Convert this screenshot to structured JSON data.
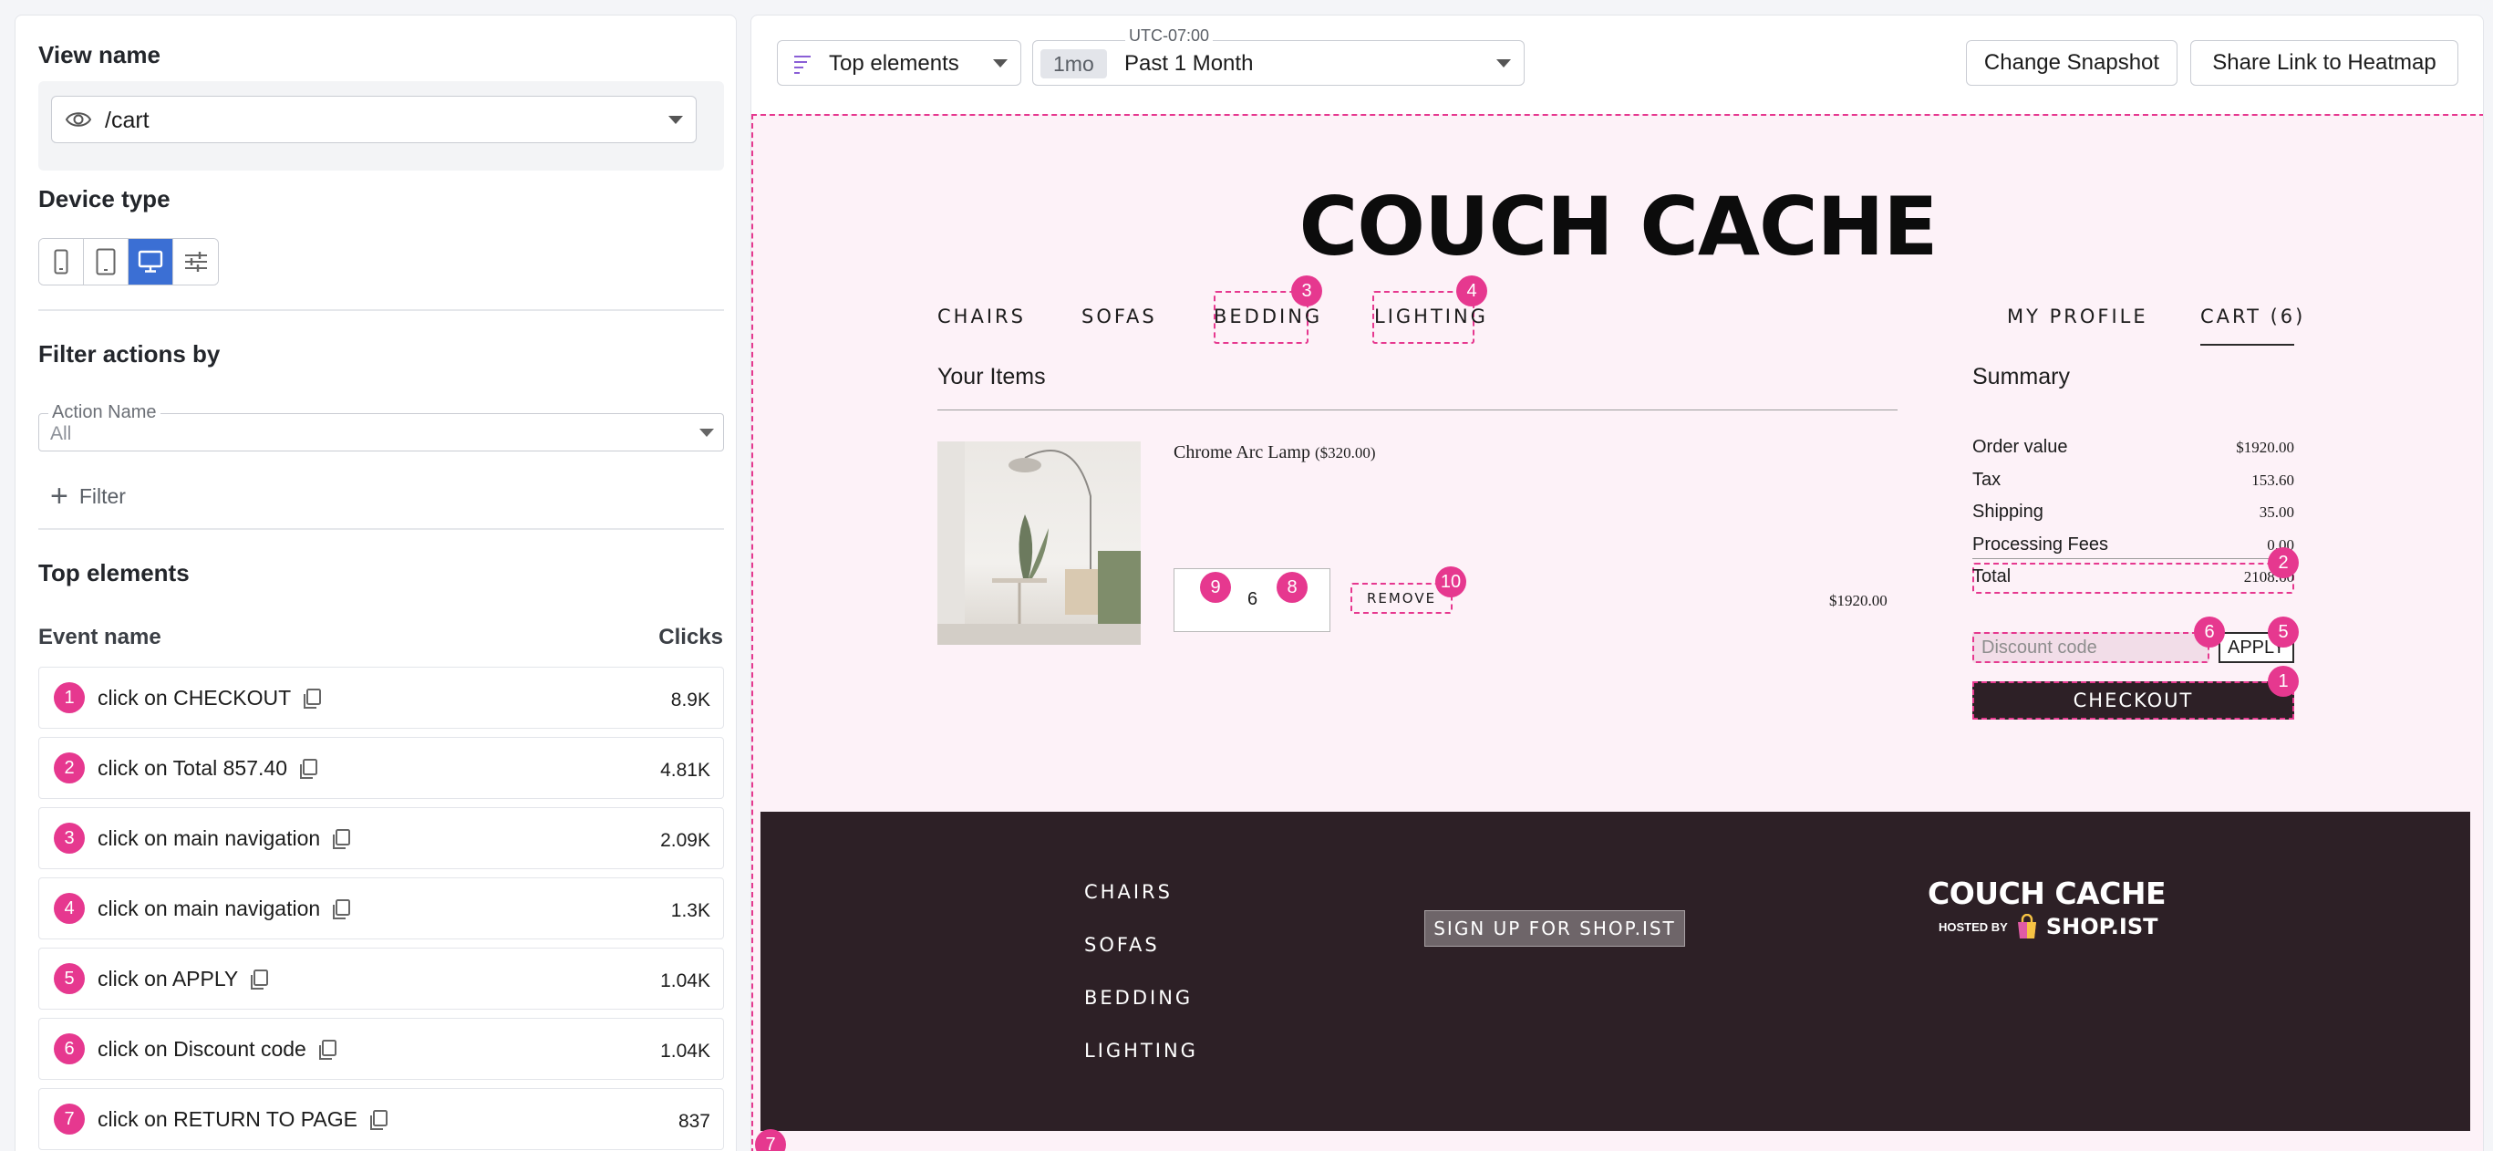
{
  "left": {
    "view_name_title": "View name",
    "view_name_value": "/cart",
    "device_type_title": "Device type",
    "device_buttons": [
      "mobile-icon",
      "tablet-icon",
      "desktop-icon",
      "custom-sliders-icon"
    ],
    "active_device": "desktop",
    "filter_title": "Filter actions by",
    "action_name_label": "Action Name",
    "action_name_value": "All",
    "filter_button": "Filter",
    "top_elements_title": "Top elements",
    "col_event": "Event name",
    "col_clicks": "Clicks",
    "events": [
      {
        "n": "1",
        "name": "click on CHECKOUT",
        "clicks": "8.9K"
      },
      {
        "n": "2",
        "name": "click on Total 857.40",
        "clicks": "4.81K"
      },
      {
        "n": "3",
        "name": "click on main navigation",
        "clicks": "2.09K"
      },
      {
        "n": "4",
        "name": "click on main navigation",
        "clicks": "1.3K"
      },
      {
        "n": "5",
        "name": "click on APPLY",
        "clicks": "1.04K"
      },
      {
        "n": "6",
        "name": "click on Discount code",
        "clicks": "1.04K"
      },
      {
        "n": "7",
        "name": "click on RETURN TO PAGE",
        "clicks": "837"
      }
    ]
  },
  "toolbar": {
    "mode": "Top elements",
    "timezone": "UTC-07:00",
    "range_chip": "1mo",
    "range": "Past 1 Month",
    "change_snapshot": "Change Snapshot",
    "share_link": "Share Link to Heatmap"
  },
  "store": {
    "title": "COUCH CACHE",
    "nav": [
      "CHAIRS",
      "SOFAS",
      "BEDDING",
      "LIGHTING"
    ],
    "my_profile": "MY PROFILE",
    "cart": "CART (6)",
    "your_items": "Your Items",
    "product_name": "Chrome Arc Lamp",
    "product_price": "($320.00)",
    "qty": "6",
    "remove": "REMOVE",
    "line_total": "$1920.00",
    "summary": "Summary",
    "summary_rows": [
      {
        "label": "Order value",
        "value": "$1920.00"
      },
      {
        "label": "Tax",
        "value": "153.60"
      },
      {
        "label": "Shipping",
        "value": "35.00"
      },
      {
        "label": "Processing Fees",
        "value": "0.00"
      }
    ],
    "total_label": "Total",
    "total_value": "2108.60",
    "discount_placeholder": "Discount code",
    "apply": "APPLY",
    "checkout": "CHECKOUT",
    "footer_nav": [
      "CHAIRS",
      "SOFAS",
      "BEDDING",
      "LIGHTING"
    ],
    "signup": "SIGN UP FOR SHOP.IST",
    "footer_logo": "COUCH CACHE",
    "hosted_by": "HOSTED BY",
    "shop_name": "SHOP.IST"
  },
  "markers": [
    "1",
    "2",
    "3",
    "4",
    "5",
    "6",
    "7",
    "8",
    "9",
    "10"
  ],
  "colors": {
    "accent": "#e6388f",
    "primary_blue": "#3b6fd4",
    "store_bg": "#fdf2f8",
    "footer_bg": "#2d2026"
  }
}
